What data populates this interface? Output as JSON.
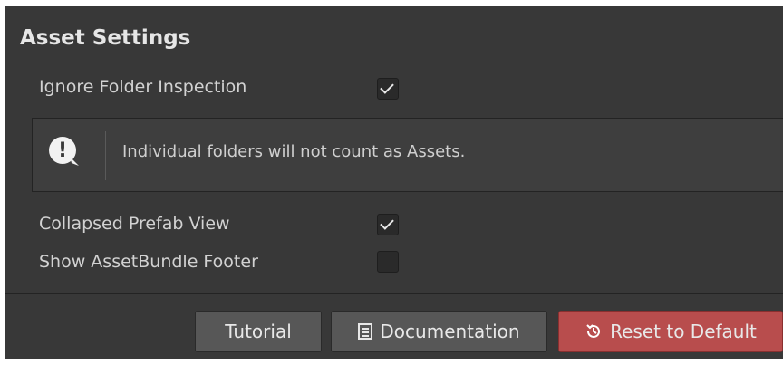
{
  "section": {
    "title": "Asset Settings"
  },
  "settings": [
    {
      "label": "Ignore Folder Inspection",
      "checked": true
    },
    {
      "label": "Collapsed Prefab View",
      "checked": true
    },
    {
      "label": "Show AssetBundle Footer",
      "checked": false
    }
  ],
  "info": {
    "icon": "exclamation-speech-icon",
    "message": "Individual folders will not count as Assets."
  },
  "buttons": {
    "tutorial": "Tutorial",
    "documentation": "Documentation",
    "documentation_icon": "document-icon",
    "reset": "Reset to Default",
    "reset_icon": "history-icon"
  },
  "colors": {
    "panel_bg": "#383838",
    "button_bg": "#575757",
    "reset_bg": "#b84d4d"
  }
}
